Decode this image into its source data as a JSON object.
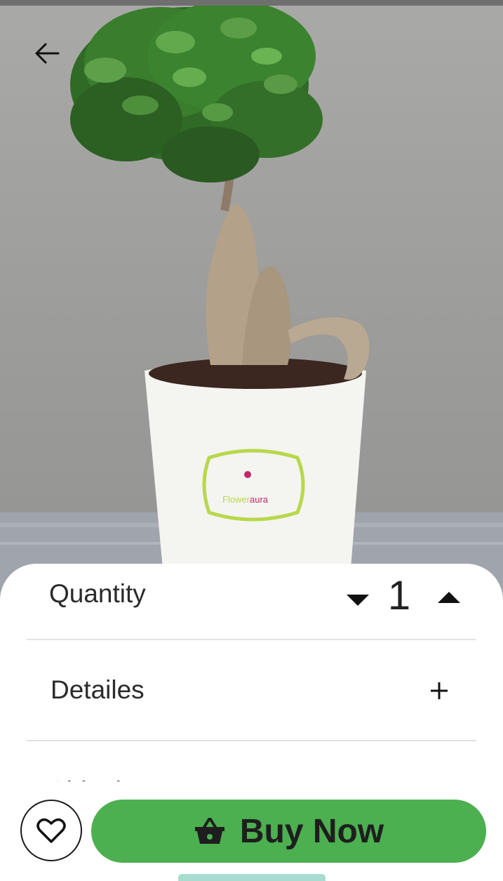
{
  "header": {
    "back_icon": "arrow-left-icon"
  },
  "product": {
    "image_alt": "Bonsai plant in white pot",
    "pot_brand": {
      "prefix": "Flower",
      "suffix": "aura"
    }
  },
  "quantity": {
    "label": "Quantity",
    "value": "1",
    "decrease_icon": "caret-down-icon",
    "increase_icon": "caret-up-icon"
  },
  "details": {
    "label": "Detailes",
    "icon": "plus-icon"
  },
  "shipping": {
    "label": "Shipping & Payment",
    "icon": "plus-icon"
  },
  "actions": {
    "wishlist_icon": "heart-outline-icon",
    "buy_icon": "shopping-basket-icon",
    "buy_label": "Buy Now"
  },
  "colors": {
    "accent": "#4caf50",
    "text": "#2b2b2b",
    "divider": "#e2e2e2",
    "handle": "#a8dccf"
  }
}
